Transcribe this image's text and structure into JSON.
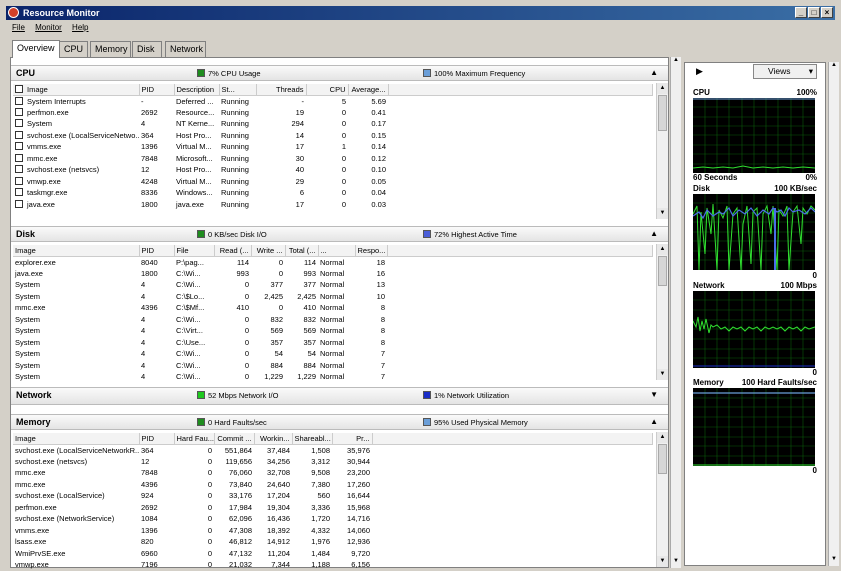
{
  "window": {
    "title": "Resource Monitor"
  },
  "menu": [
    "File",
    "Monitor",
    "Help"
  ],
  "tabs": [
    "Overview",
    "CPU",
    "Memory",
    "Disk",
    "Network"
  ],
  "cpu": {
    "title": "CPU",
    "usage_label": "7% CPU Usage",
    "freq_label": "100% Maximum Frequency",
    "usage_color": "#1e8c1e",
    "freq_color": "#6a9ed8",
    "columns": [
      "Image",
      "PID",
      "Description",
      "St...",
      "Threads",
      "CPU",
      "Average..."
    ],
    "rows": [
      [
        "System Interrupts",
        "-",
        "Deferred ...",
        "Running",
        "-",
        "5",
        "5.69"
      ],
      [
        "perfmon.exe",
        "2692",
        "Resource...",
        "Running",
        "19",
        "0",
        "0.41"
      ],
      [
        "System",
        "4",
        "NT Kerne...",
        "Running",
        "294",
        "0",
        "0.17"
      ],
      [
        "svchost.exe (LocalServiceNetwo...",
        "364",
        "Host Pro...",
        "Running",
        "14",
        "0",
        "0.15"
      ],
      [
        "vmms.exe",
        "1396",
        "Virtual M...",
        "Running",
        "17",
        "1",
        "0.14"
      ],
      [
        "mmc.exe",
        "7848",
        "Microsoft...",
        "Running",
        "30",
        "0",
        "0.12"
      ],
      [
        "svchost.exe (netsvcs)",
        "12",
        "Host Pro...",
        "Running",
        "40",
        "0",
        "0.10"
      ],
      [
        "vmwp.exe",
        "4248",
        "Virtual M...",
        "Running",
        "29",
        "0",
        "0.05"
      ],
      [
        "taskmgr.exe",
        "8336",
        "Windows...",
        "Running",
        "6",
        "0",
        "0.04"
      ],
      [
        "java.exe",
        "1800",
        "java.exe",
        "Running",
        "17",
        "0",
        "0.03"
      ]
    ]
  },
  "disk": {
    "title": "Disk",
    "io_label": "0 KB/sec Disk I/O",
    "active_label": "72% Highest Active Time",
    "io_color": "#1e8c1e",
    "active_color": "#4a5ed8",
    "columns": [
      "Image",
      "PID",
      "File",
      "Read (...",
      "Write ...",
      "Total (...",
      "...",
      "Respo..."
    ],
    "rows": [
      [
        "explorer.exe",
        "8040",
        "P:\\pag...",
        "114",
        "0",
        "114",
        "Normal",
        "18"
      ],
      [
        "java.exe",
        "1800",
        "C:\\Wi...",
        "993",
        "0",
        "993",
        "Normal",
        "16"
      ],
      [
        "System",
        "4",
        "C:\\Wi...",
        "0",
        "377",
        "377",
        "Normal",
        "13"
      ],
      [
        "System",
        "4",
        "C:\\$Lo...",
        "0",
        "2,425",
        "2,425",
        "Normal",
        "10"
      ],
      [
        "mmc.exe",
        "4396",
        "C:\\$Mf...",
        "410",
        "0",
        "410",
        "Normal",
        "8"
      ],
      [
        "System",
        "4",
        "C:\\Wi...",
        "0",
        "832",
        "832",
        "Normal",
        "8"
      ],
      [
        "System",
        "4",
        "C:\\Virt...",
        "0",
        "569",
        "569",
        "Normal",
        "8"
      ],
      [
        "System",
        "4",
        "C:\\Use...",
        "0",
        "357",
        "357",
        "Normal",
        "8"
      ],
      [
        "System",
        "4",
        "C:\\Wi...",
        "0",
        "54",
        "54",
        "Normal",
        "7"
      ],
      [
        "System",
        "4",
        "C:\\Wi...",
        "0",
        "884",
        "884",
        "Normal",
        "7"
      ],
      [
        "System",
        "4",
        "C:\\Wi...",
        "0",
        "1,229",
        "1,229",
        "Normal",
        "7"
      ]
    ]
  },
  "network": {
    "title": "Network",
    "io_label": "52 Mbps Network I/O",
    "util_label": "1% Network Utilization",
    "io_color": "#1ec81e",
    "util_color": "#1a2ec8"
  },
  "memory": {
    "title": "Memory",
    "faults_label": "0 Hard Faults/sec",
    "used_label": "95% Used Physical Memory",
    "faults_color": "#1e8c1e",
    "used_color": "#6a9ed8",
    "columns": [
      "Image",
      "PID",
      "Hard Fau...",
      "Commit ...",
      "Workin...",
      "Shareabl...",
      "Pr..."
    ],
    "rows": [
      [
        "svchost.exe (LocalServiceNetworkR...",
        "364",
        "0",
        "551,864",
        "37,484",
        "1,508",
        "35,976"
      ],
      [
        "svchost.exe (netsvcs)",
        "12",
        "0",
        "119,656",
        "34,256",
        "3,312",
        "30,944"
      ],
      [
        "mmc.exe",
        "7848",
        "0",
        "76,060",
        "32,708",
        "9,508",
        "23,200"
      ],
      [
        "mmc.exe",
        "4396",
        "0",
        "73,840",
        "24,640",
        "7,380",
        "17,260"
      ],
      [
        "svchost.exe (LocalService)",
        "924",
        "0",
        "33,176",
        "17,204",
        "560",
        "16,644"
      ],
      [
        "perfmon.exe",
        "2692",
        "0",
        "17,984",
        "19,304",
        "3,336",
        "15,968"
      ],
      [
        "svchost.exe (NetworkService)",
        "1084",
        "0",
        "62,096",
        "16,436",
        "1,720",
        "14,716"
      ],
      [
        "vmms.exe",
        "1396",
        "0",
        "47,308",
        "18,392",
        "4,332",
        "14,060"
      ],
      [
        "lsass.exe",
        "820",
        "0",
        "46,812",
        "14,912",
        "1,976",
        "12,936"
      ],
      [
        "WmiPrvSE.exe",
        "6960",
        "0",
        "47,132",
        "11,204",
        "1,484",
        "9,720"
      ],
      [
        "vmwp.exe",
        "7196",
        "0",
        "21,032",
        "7,344",
        "1,188",
        "6,156"
      ]
    ]
  },
  "side": {
    "views_label": "Views",
    "cpu_graph": {
      "label": "CPU",
      "max": "100%",
      "time": "60 Seconds",
      "min": "0%"
    },
    "disk_graph": {
      "label": "Disk",
      "max": "100 KB/sec",
      "min": "0"
    },
    "network_graph": {
      "label": "Network",
      "max": "100 Mbps",
      "min": "0"
    },
    "memory_graph": {
      "label": "Memory",
      "max": "100 Hard Faults/sec",
      "min": "0"
    }
  }
}
